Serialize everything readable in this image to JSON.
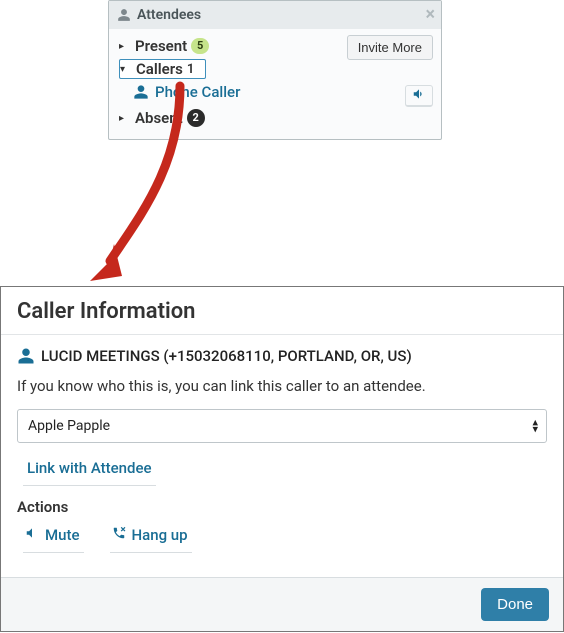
{
  "attendees_panel": {
    "title": "Attendees",
    "invite_label": "Invite More",
    "groups": {
      "present": {
        "label": "Present",
        "count": "5"
      },
      "callers": {
        "label": "Callers",
        "count": "1",
        "items": [
          {
            "name": "Phone Caller"
          }
        ]
      },
      "absent": {
        "label": "Absent",
        "count": "2"
      }
    }
  },
  "dialog": {
    "title": "Caller Information",
    "caller_display": "LUCID MEETINGS (+15032068110, PORTLAND, OR, US)",
    "help_text": "If you know who this is, you can link this caller to an attendee.",
    "selected_attendee": "Apple Papple",
    "link_label": "Link with Attendee",
    "actions_heading": "Actions",
    "mute_label": "Mute",
    "hangup_label": "Hang up",
    "done_label": "Done"
  },
  "colors": {
    "link": "#1a6e95",
    "primary_button": "#2f7fa8",
    "arrow": "#c5281c"
  }
}
